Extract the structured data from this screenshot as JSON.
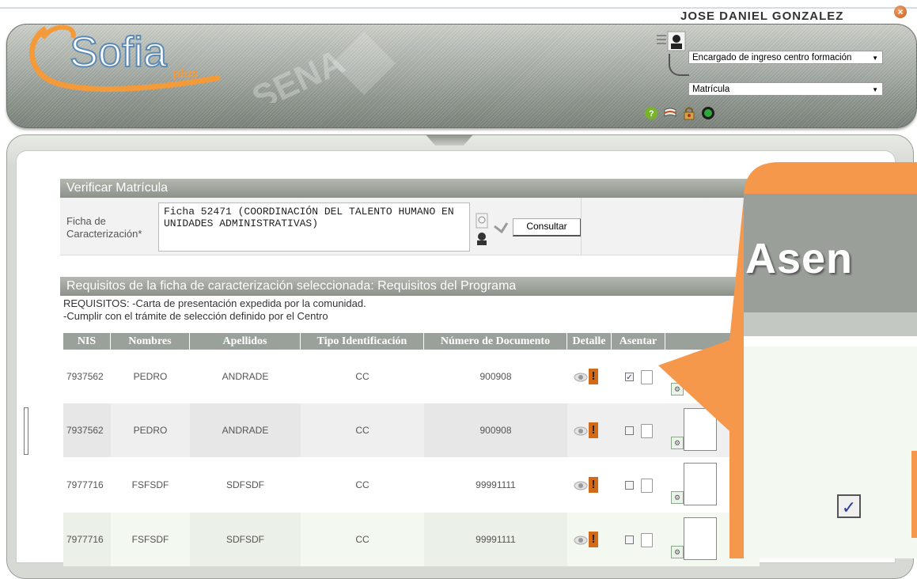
{
  "header": {
    "app_name": "Sofia",
    "app_sub": "plus",
    "watermark": "SENA",
    "user_name": "JOSE DANIEL GONZALEZ",
    "role_select": "Encargado de ingreso centro formación",
    "module_select": "Matrícula",
    "icons": [
      "help-icon",
      "book-icon",
      "lock-icon",
      "power-icon"
    ]
  },
  "form": {
    "title": "Verificar Matrícula",
    "ficha_label": "Ficha de Caracterización*",
    "ficha_value": "Ficha 52471 (COORDINACIÓN DEL TALENTO HUMANO EN UNIDADES ADMINISTRATIVAS)",
    "consultar_label": "Consultar"
  },
  "requisitos": {
    "title": "Requisitos de la ficha de caracterización seleccionada: Requisitos del Programa",
    "line1": "REQUISITOS: -Carta de presentación expedida por la comunidad.",
    "line2": "-Cumplir con el trámite de selección definido por el Centro"
  },
  "table": {
    "columns": [
      "NIS",
      "Nombres",
      "Apellidos",
      "Tipo Identificación",
      "Número de Documento",
      "Detalle",
      "Asentar"
    ],
    "rows": [
      {
        "nis": "7937562",
        "nombres": "PEDRO",
        "apellidos": "ANDRADE",
        "tipo": "CC",
        "documento": "900908",
        "asentar": true
      },
      {
        "nis": "7937562",
        "nombres": "PEDRO",
        "apellidos": "ANDRADE",
        "tipo": "CC",
        "documento": "900908",
        "asentar": false
      },
      {
        "nis": "7977716",
        "nombres": "FSFSDF",
        "apellidos": "SDFSDF",
        "tipo": "CC",
        "documento": "99991111",
        "asentar": false
      },
      {
        "nis": "7977716",
        "nombres": "FSFSDF",
        "apellidos": "SDFSDF",
        "tipo": "CC",
        "documento": "99991111",
        "asentar": false
      }
    ]
  },
  "zoom": {
    "label": "Asen",
    "checkbox_checked": true
  },
  "colors": {
    "callout": "#f6984b",
    "header_bar": "#9aa19a",
    "row_alt": "#efefef",
    "row_green": "#f3f8f0"
  }
}
